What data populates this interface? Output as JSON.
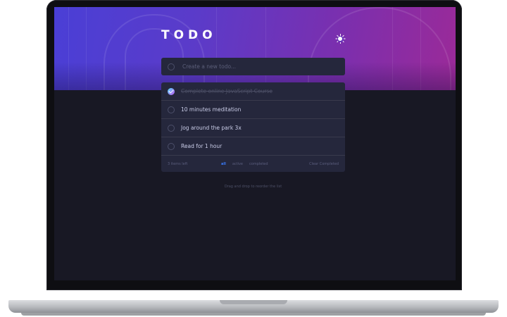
{
  "app": {
    "title": "TODO"
  },
  "new_todo": {
    "placeholder": "Create a new todo..."
  },
  "todos": [
    {
      "label": "Complete online JavaScript Course",
      "completed": true
    },
    {
      "label": "10 minutes meditation",
      "completed": false
    },
    {
      "label": "Jog around the park 3x",
      "completed": false
    },
    {
      "label": "Read for 1 hour",
      "completed": false
    }
  ],
  "footer": {
    "items_left": "3 items left",
    "filters": [
      "all",
      "active",
      "completed"
    ],
    "active_filter": "all",
    "clear_label": "Clear Completed"
  },
  "hint": "Drag and drop to reorder the list",
  "icons": {
    "theme_toggle": "sun-icon",
    "checked": "check-icon"
  },
  "colors": {
    "gradient_start": "#4a3fd6",
    "gradient_end": "#9b2a98",
    "card": "#25273c",
    "background": "#181824",
    "active_filter": "#3a7cfd",
    "check_gradient_start": "#57ddff",
    "check_gradient_end": "#c058f3"
  }
}
